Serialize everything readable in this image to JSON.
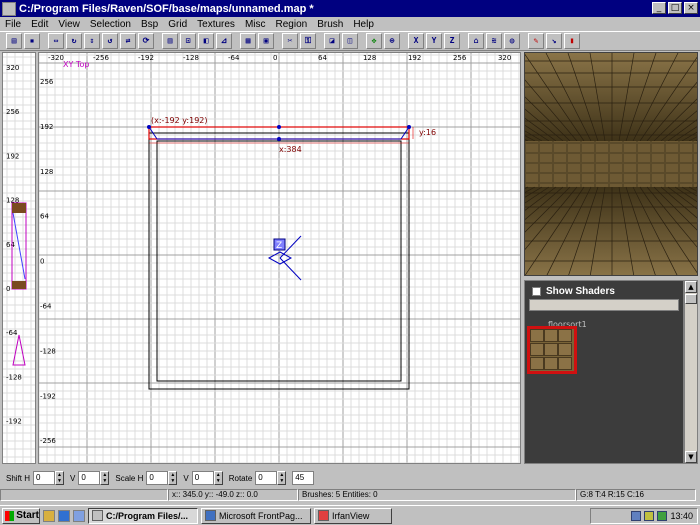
{
  "window": {
    "title": "C:/Program Files/Raven/SOF/base/maps/unnamed.map *",
    "controls": [
      "_",
      "□",
      "×"
    ]
  },
  "menu": [
    "File",
    "Edit",
    "View",
    "Selection",
    "Bsp",
    "Grid",
    "Textures",
    "Misc",
    "Region",
    "Brush",
    "Help"
  ],
  "toolbar": {
    "buttons": [
      {
        "name": "open",
        "glyph": "▤"
      },
      {
        "name": "save",
        "glyph": "▪"
      },
      {
        "name": "flip-x",
        "glyph": "⇔"
      },
      {
        "name": "rotate-x",
        "glyph": "↻"
      },
      {
        "name": "flip-y",
        "glyph": "⇕"
      },
      {
        "name": "rotate-y",
        "glyph": "↺"
      },
      {
        "name": "flip-z",
        "glyph": "⇄"
      },
      {
        "name": "rotate-z",
        "glyph": "⟳"
      },
      {
        "name": "complete-tall",
        "glyph": "▥"
      },
      {
        "name": "size-to-fit",
        "glyph": "⊡"
      },
      {
        "name": "face-select",
        "glyph": "◧"
      },
      {
        "name": "bend",
        "glyph": "⊿"
      },
      {
        "name": "grid",
        "glyph": "▦"
      },
      {
        "name": "frame",
        "glyph": "▣"
      },
      {
        "name": "clipper",
        "glyph": "✂"
      },
      {
        "name": "texture-lock",
        "glyph": "⚿"
      },
      {
        "name": "change-views",
        "glyph": "◪"
      },
      {
        "name": "cubic-clip",
        "glyph": "◫"
      },
      {
        "name": "camera-movement",
        "glyph": "✥"
      },
      {
        "name": "view-xy",
        "glyph": "⊕"
      },
      {
        "name": "axis-x",
        "glyph": "X"
      },
      {
        "name": "axis-y",
        "glyph": "Y"
      },
      {
        "name": "axis-z",
        "glyph": "Z"
      },
      {
        "name": "entities",
        "glyph": "⌂"
      },
      {
        "name": "patch",
        "glyph": "≋"
      },
      {
        "name": "show-patches",
        "glyph": "◍"
      },
      {
        "name": "paint",
        "glyph": "✎"
      },
      {
        "name": "drag",
        "glyph": "↘"
      },
      {
        "name": "redisperse",
        "glyph": "▮"
      }
    ]
  },
  "xyview": {
    "label": "XY Top",
    "x_ticks": [
      "-320",
      "-256",
      "-192",
      "-128",
      "-64",
      "0",
      "64",
      "128",
      "192",
      "256",
      "320"
    ],
    "y_ticks": [
      "256",
      "192",
      "128",
      "64",
      "0",
      "-64",
      "-128",
      "-192",
      "-256"
    ],
    "brush_origin_label": "(x:-192  y:192)",
    "brush_height_label": "y:16",
    "brush_width_label": "x:384",
    "z_marker": "Z"
  },
  "zview": {
    "ticks": [
      "320",
      "256",
      "192",
      "128",
      "64",
      "0",
      "-64",
      "-128",
      "-192",
      "-256"
    ]
  },
  "textures": {
    "show_shaders_label": "Show Shaders",
    "texture_name": "floorsort1",
    "colors": {
      "selected_border": "#d01010"
    }
  },
  "bottombar": {
    "shift_h_label": "Shift H",
    "shift_h": "0",
    "shift_v_label": "V",
    "shift_v": "0",
    "scale_h_label": "Scale H",
    "scale_h": "0",
    "scale_v_label": "V",
    "scale_v": "0",
    "rotate_label": "Rotate",
    "rotate": "0",
    "rotate_step": "45"
  },
  "status": {
    "coords": "x:: 345.0  y:: -49.0  z:: 0.0",
    "counts": "Brushes: 5 Entities: 0",
    "grid": "G:8 T:4 R:15 C:16"
  },
  "taskbar": {
    "start_label": "Start",
    "tasks": [
      {
        "label": "C:/Program Files/...",
        "active": true
      },
      {
        "label": "Microsoft FrontPag...",
        "active": false
      },
      {
        "label": "IrfanView",
        "active": false
      }
    ],
    "clock": "13:40"
  }
}
